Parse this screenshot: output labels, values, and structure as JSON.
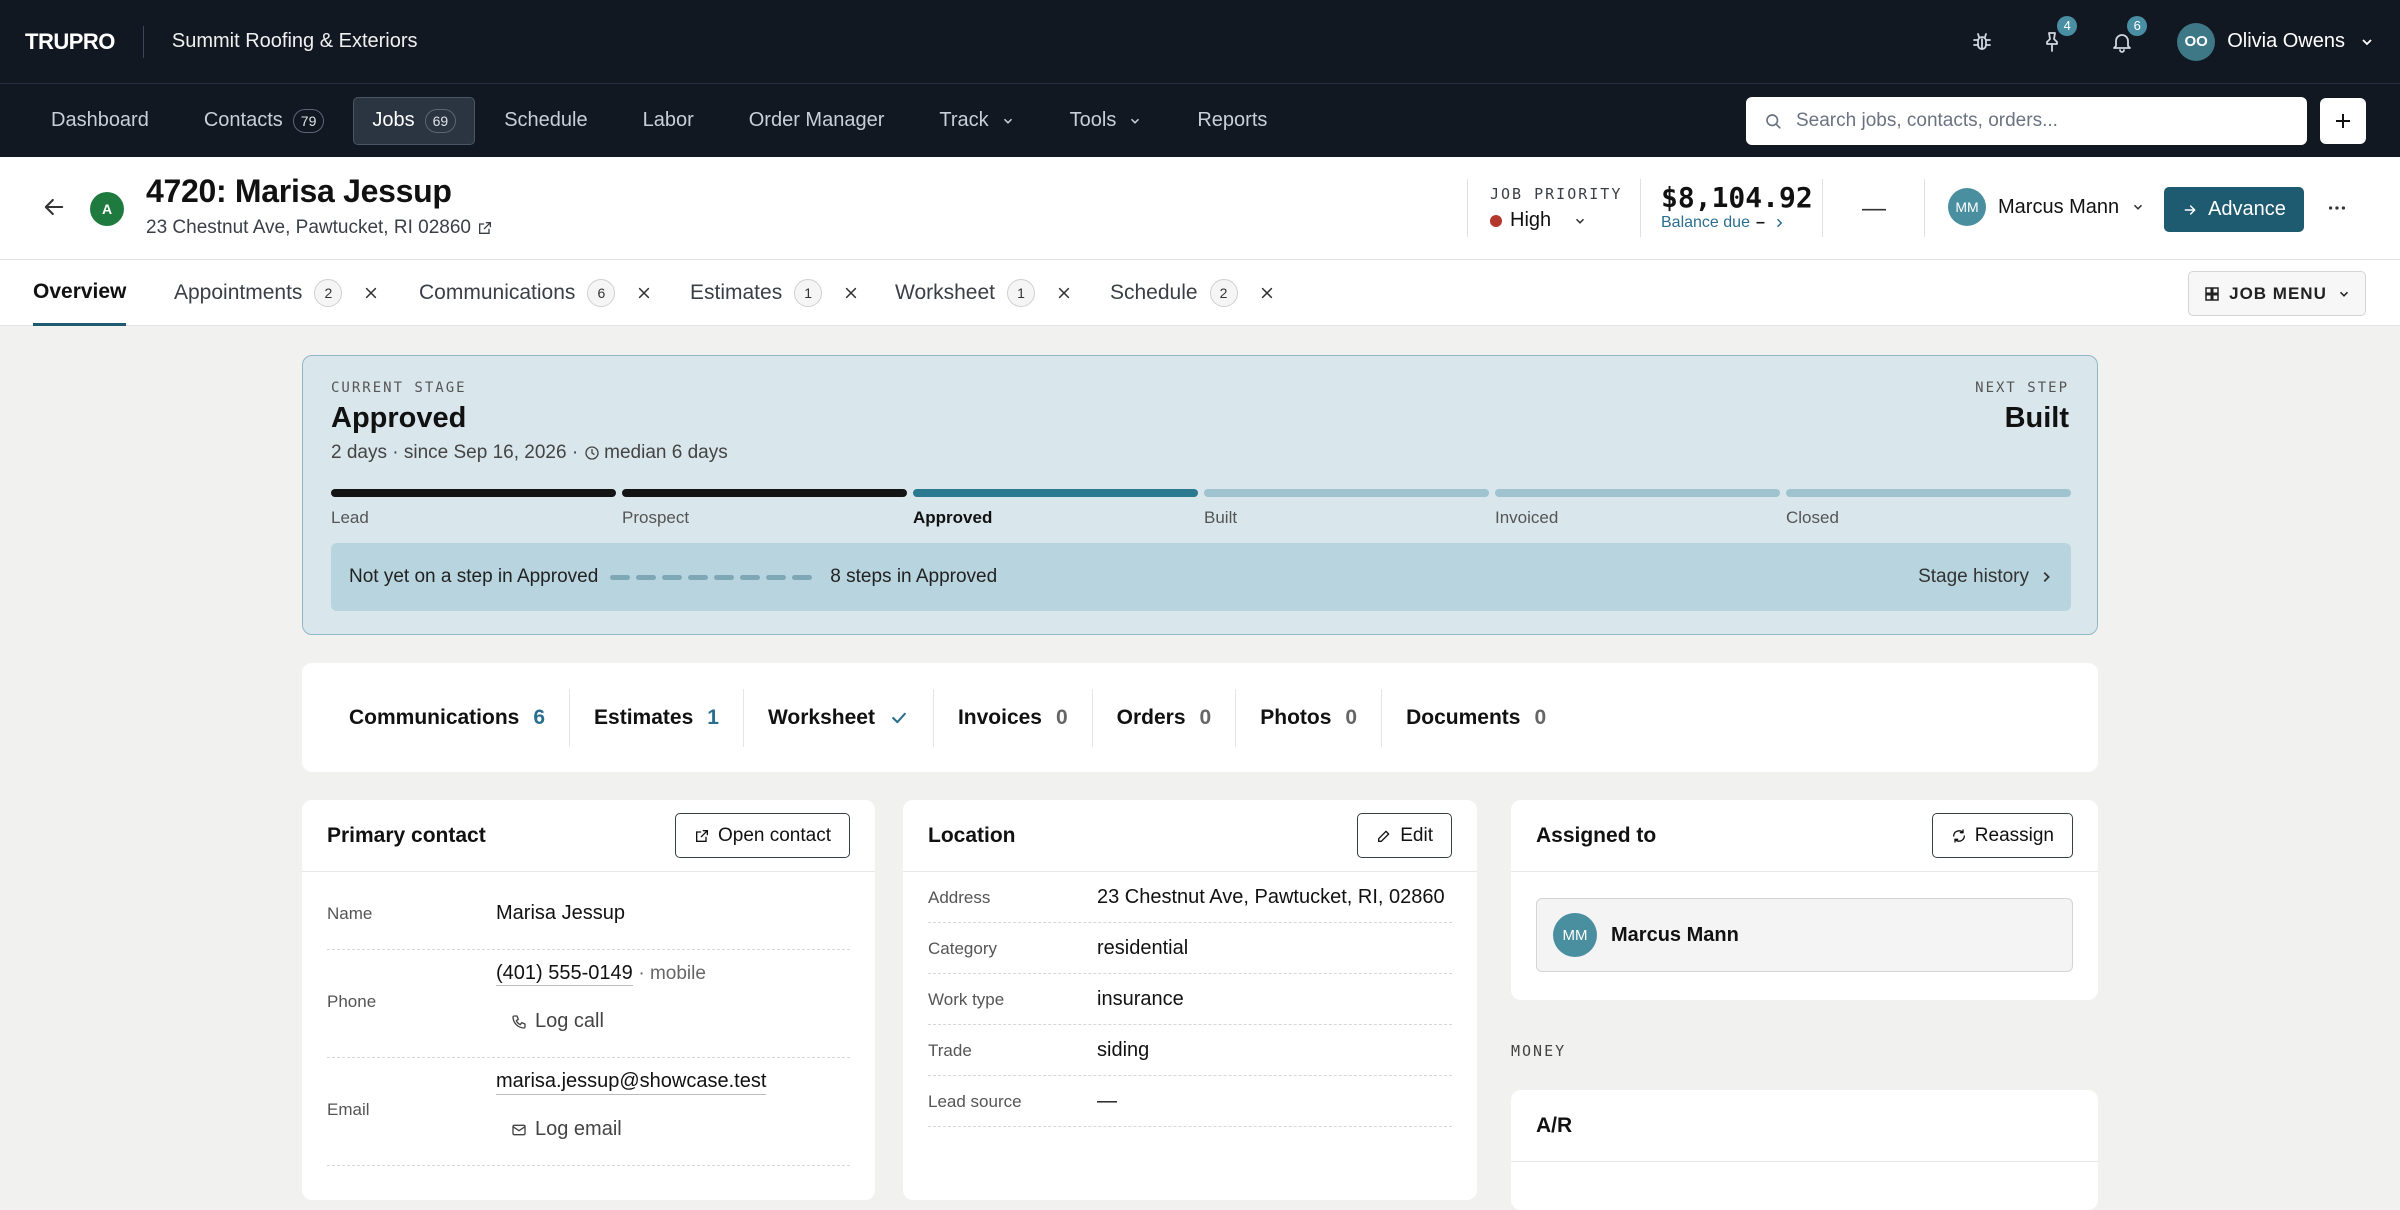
{
  "app": {
    "logo": "TRUPRO",
    "company": "Summit Roofing & Exteriors"
  },
  "topbar": {
    "icons": [
      {
        "name": "bug-icon",
        "badge": ""
      },
      {
        "name": "pin-icon",
        "badge": "4"
      },
      {
        "name": "bell-icon",
        "badge": "6"
      }
    ],
    "user": {
      "initials": "OO",
      "name": "Olivia Owens"
    }
  },
  "nav": {
    "items": [
      {
        "label": "Dashboard",
        "count": "",
        "caret": false,
        "active": false
      },
      {
        "label": "Contacts",
        "count": "79",
        "caret": false,
        "active": false
      },
      {
        "label": "Jobs",
        "count": "69",
        "caret": false,
        "active": true
      },
      {
        "label": "Schedule",
        "count": "",
        "caret": false,
        "active": false
      },
      {
        "label": "Labor",
        "count": "",
        "caret": false,
        "active": false
      },
      {
        "label": "Order Manager",
        "count": "",
        "caret": false,
        "active": false
      },
      {
        "label": "Track",
        "count": "",
        "caret": true,
        "active": false
      },
      {
        "label": "Tools",
        "count": "",
        "caret": true,
        "active": false
      },
      {
        "label": "Reports",
        "count": "",
        "caret": false,
        "active": false
      }
    ],
    "search_placeholder": "Search jobs, contacts, orders..."
  },
  "job": {
    "stage_initial": "A",
    "title": "4720: Marisa Jessup",
    "address": "23 Chestnut Ave, Pawtucket, RI 02860",
    "priority_label": "JOB PRIORITY",
    "priority": "High",
    "amount": "$8,104.92",
    "balance_label": "Balance due",
    "balance_value": "–",
    "middle_dash": "—",
    "owner": {
      "initials": "MM",
      "name": "Marcus Mann"
    },
    "advance_label": "Advance"
  },
  "tabs": {
    "items": [
      {
        "label": "Overview",
        "count": "",
        "closable": false,
        "active": true
      },
      {
        "label": "Appointments",
        "count": "2",
        "closable": true,
        "active": false
      },
      {
        "label": "Communications",
        "count": "6",
        "closable": true,
        "active": false
      },
      {
        "label": "Estimates",
        "count": "1",
        "closable": true,
        "active": false
      },
      {
        "label": "Worksheet",
        "count": "1",
        "closable": true,
        "active": false
      },
      {
        "label": "Schedule",
        "count": "2",
        "closable": true,
        "active": false
      }
    ],
    "job_menu_label": "JOB MENU"
  },
  "stage": {
    "current_label": "CURRENT STAGE",
    "current": "Approved",
    "next_label": "NEXT STEP",
    "next": "Built",
    "meta": "2 days · since Sep 16, 2026 ·",
    "median": "median 6 days",
    "steps": [
      {
        "label": "Lead",
        "state": "done"
      },
      {
        "label": "Prospect",
        "state": "done"
      },
      {
        "label": "Approved",
        "state": "current"
      },
      {
        "label": "Built",
        "state": "todo"
      },
      {
        "label": "Invoiced",
        "state": "todo"
      },
      {
        "label": "Closed",
        "state": "todo"
      }
    ],
    "substep_text": "Not yet on a step in Approved",
    "substep_count": 8,
    "substep_summary": "8 steps in Approved",
    "history_label": "Stage history"
  },
  "counts": [
    {
      "label": "Communications",
      "value": "6",
      "accent": true,
      "check": false
    },
    {
      "label": "Estimates",
      "value": "1",
      "accent": true,
      "check": false
    },
    {
      "label": "Worksheet",
      "value": "",
      "accent": false,
      "check": true
    },
    {
      "label": "Invoices",
      "value": "0",
      "accent": false,
      "check": false
    },
    {
      "label": "Orders",
      "value": "0",
      "accent": false,
      "check": false
    },
    {
      "label": "Photos",
      "value": "0",
      "accent": false,
      "check": false
    },
    {
      "label": "Documents",
      "value": "0",
      "accent": false,
      "check": false
    }
  ],
  "primary_contact": {
    "title": "Primary contact",
    "button": "Open contact",
    "name_label": "Name",
    "name": "Marisa Jessup",
    "phone_label": "Phone",
    "phone": "(401) 555-0149",
    "phone_type": "· mobile",
    "log_call": "Log call",
    "email_label": "Email",
    "email": "marisa.jessup@showcase.test",
    "log_email": "Log email"
  },
  "location": {
    "title": "Location",
    "button": "Edit",
    "fields": [
      {
        "label": "Address",
        "value": "23 Chestnut Ave, Pawtucket, RI, 02860"
      },
      {
        "label": "Category",
        "value": "residential"
      },
      {
        "label": "Work type",
        "value": "insurance"
      },
      {
        "label": "Trade",
        "value": "siding"
      },
      {
        "label": "Lead source",
        "value": "—"
      }
    ]
  },
  "assigned": {
    "title": "Assigned to",
    "button": "Reassign",
    "initials": "MM",
    "name": "Marcus Mann"
  },
  "money": {
    "section_label": "MONEY",
    "ar_title": "A/R"
  },
  "colors": {
    "topbar_bg": "#121821",
    "accent": "#1e5a70",
    "stage_card_bg": "#d9e7ec",
    "priority_high": "#b3372b",
    "stage_chip": "#1f7a3f"
  }
}
